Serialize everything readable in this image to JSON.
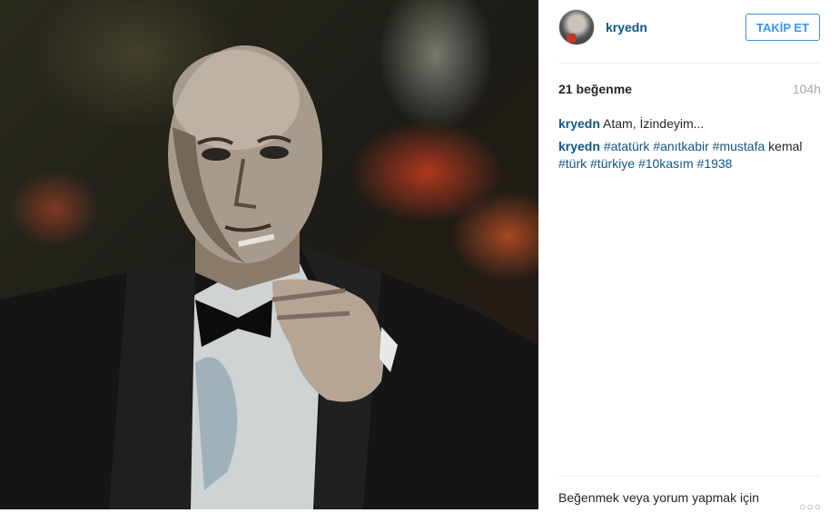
{
  "post": {
    "username": "kryedn",
    "follow_label": "TAKİP ET",
    "likes": "21 beğenme",
    "time": "104h",
    "caption_user": "kryedn",
    "caption_text": "Atam, İzindeyim...",
    "comment_user": "kryedn",
    "comment_tokens": [
      "#atatürk",
      "#anıtkabir",
      "#mustafa",
      "kemal",
      "#türk",
      "#türkiye",
      "#10kasım",
      "#1938"
    ],
    "login_prompt": "Beğenmek veya yorum yapmak için",
    "more_icon": "more-options-icon"
  },
  "colors": {
    "link": "#125688",
    "follow": "#3897f0",
    "muted": "#a5a7aa"
  }
}
